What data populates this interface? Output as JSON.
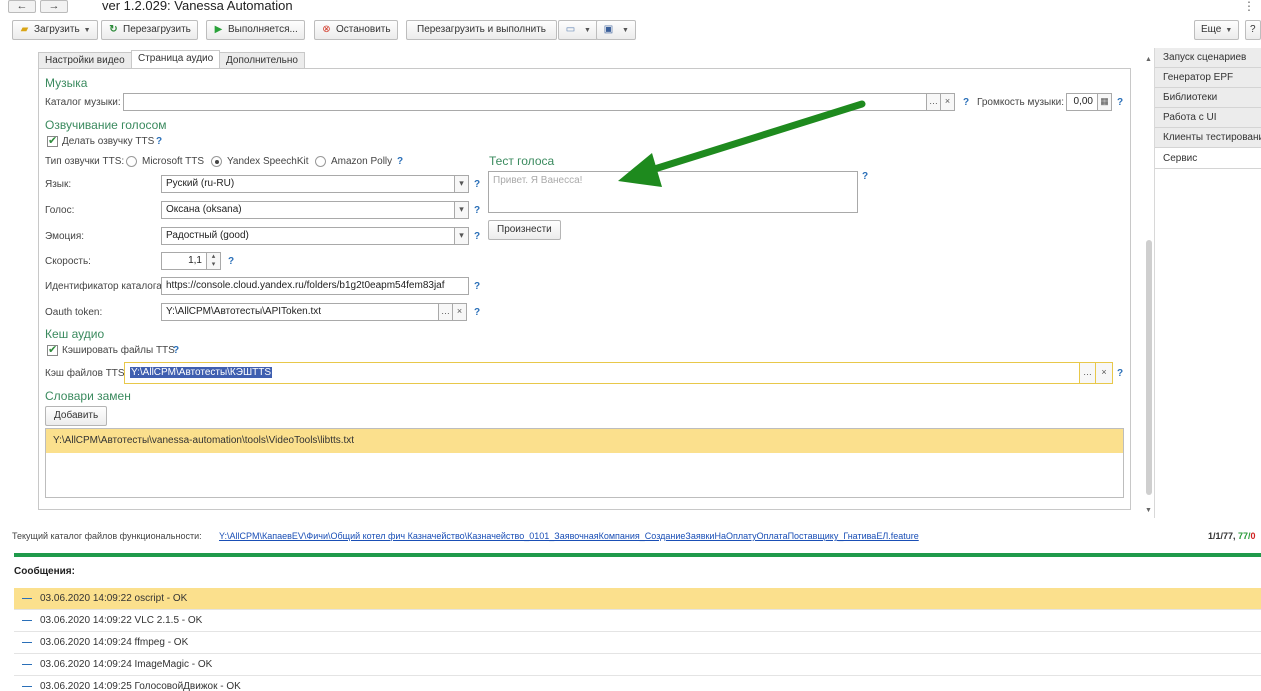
{
  "window": {
    "title": "ver 1.2.029: Vanessa Automation",
    "back": "←",
    "forward": "→",
    "more": "⋮"
  },
  "toolbar": {
    "load": "Загрузить",
    "reload": "Перезагрузить",
    "running": "Выполняется...",
    "stop": "Остановить",
    "reload_run": "Перезагрузить и выполнить",
    "more": "Еще",
    "help": "?"
  },
  "tabs": [
    "Настройки видео",
    "Страница аудио",
    "Дополнительно"
  ],
  "music": {
    "section": "Музыка",
    "catalog_label": "Каталог музыки:",
    "catalog_value": "",
    "volume_label": "Громкость музыки:",
    "volume_value": "0,00"
  },
  "voice": {
    "section": "Озвучивание голосом",
    "do_tts_label": "Делать озвучку TTS",
    "tts_type_label": "Тип озвучки TTS:",
    "tts_options": [
      "Microsoft TTS",
      "Yandex SpeechKit",
      "Amazon Polly"
    ],
    "tts_selected": "Yandex SpeechKit",
    "lang_label": "Язык:",
    "lang_value": "Руский (ru-RU)",
    "voice_label": "Голос:",
    "voice_value": "Оксана (oksana)",
    "emotion_label": "Эмоция:",
    "emotion_value": "Радостный (good)",
    "speed_label": "Скорость:",
    "speed_value": "1,1",
    "catalog_id_label": "Идентификатор каталога:",
    "catalog_id_value": "https://console.cloud.yandex.ru/folders/b1g2t0eapm54fem83jaf",
    "oauth_label": "Oauth token:",
    "oauth_value": "Y:\\AllCPM\\Автотесты\\APIToken.txt"
  },
  "voice_test": {
    "section": "Тест голоса",
    "placeholder": "Привет. Я Ванесса!",
    "speak_button": "Произнести"
  },
  "cache": {
    "section": "Кеш аудио",
    "cache_files_label": "Кэшировать файлы TTS",
    "cache_dir_label": "Кэш файлов TTS:",
    "cache_dir_value": "Y:\\AllCPM\\Автотесты\\КЭШТТS"
  },
  "dictionaries": {
    "section": "Словари замен",
    "add_button": "Добавить",
    "items": [
      "Y:\\AllCPM\\Автотесты\\vanessa-automation\\tools\\VideoTools\\libtts.txt"
    ]
  },
  "right_panel": {
    "items": [
      "Запуск сценариев",
      "Генератор EPF",
      "Библиотеки",
      "Работа с UI",
      "Клиенты тестирования",
      "Сервис"
    ],
    "selected": "Сервис"
  },
  "status": {
    "current_dir_label": "Текущий каталог файлов функциональности:",
    "current_dir_value": "Y:\\AllCPM\\КапаевEV\\Фичи\\Общий котел фич Казначейство\\Казначейство_0101_ЗаявочнаяКомпания_СозданиеЗаявкиНаОплатуОплатаПоставщику_ГнативаЕЛ.feature",
    "counter_a": "1/1/77, ",
    "counter_b": "77/",
    "counter_c": "0"
  },
  "messages": {
    "title": "Сообщения:",
    "items": [
      "03.06.2020 14:09:22 oscript - OK",
      "03.06.2020 14:09:22 VLC 2.1.5 - OK",
      "03.06.2020 14:09:24 ffmpeg - OK",
      "03.06.2020 14:09:24 ImageMagic - OK",
      "03.06.2020 14:09:25 ГолосовойДвижок - OK"
    ]
  },
  "colors": {
    "section_green": "#3a8a5e",
    "arrow_green": "#1e8a1e",
    "highlight_yellow": "#fbe08d",
    "link_blue": "#1a4fb6"
  }
}
